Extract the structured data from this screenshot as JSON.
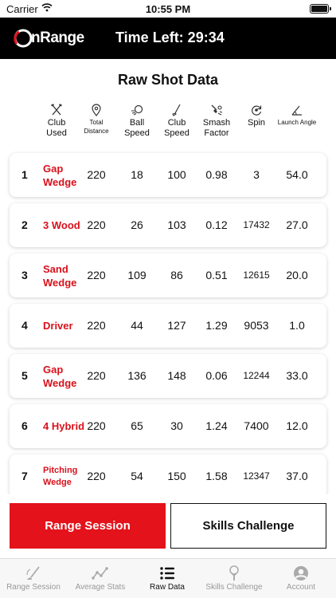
{
  "status_bar": {
    "carrier": "Carrier",
    "time": "10:55 PM"
  },
  "header": {
    "logo_text": "nRange",
    "time_left": "Time Left: 29:34"
  },
  "title": "Raw Shot Data",
  "columns": [
    {
      "label": "Club Used",
      "icon": "crossed-clubs-icon"
    },
    {
      "label": "Total Distance",
      "icon": "location-pin-icon"
    },
    {
      "label": "Ball Speed",
      "icon": "speeding-ball-icon"
    },
    {
      "label": "Club Speed",
      "icon": "golf-club-icon"
    },
    {
      "label": "Smash Factor",
      "icon": "impact-icon"
    },
    {
      "label": "Spin",
      "icon": "spin-icon"
    },
    {
      "label": "Launch Angle",
      "icon": "angle-icon"
    }
  ],
  "shots": [
    {
      "num": "1",
      "club": "Gap Wedge",
      "distance": "220",
      "ball_speed": "18",
      "club_speed": "100",
      "smash": "0.98",
      "spin": "3",
      "launch": "54.0"
    },
    {
      "num": "2",
      "club": "3 Wood",
      "distance": "220",
      "ball_speed": "26",
      "club_speed": "103",
      "smash": "0.12",
      "spin": "17432",
      "launch": "27.0"
    },
    {
      "num": "3",
      "club": "Sand Wedge",
      "distance": "220",
      "ball_speed": "109",
      "club_speed": "86",
      "smash": "0.51",
      "spin": "12615",
      "launch": "20.0"
    },
    {
      "num": "4",
      "club": "Driver",
      "distance": "220",
      "ball_speed": "44",
      "club_speed": "127",
      "smash": "1.29",
      "spin": "9053",
      "launch": "1.0"
    },
    {
      "num": "5",
      "club": "Gap Wedge",
      "distance": "220",
      "ball_speed": "136",
      "club_speed": "148",
      "smash": "0.06",
      "spin": "12244",
      "launch": "33.0"
    },
    {
      "num": "6",
      "club": "4 Hybrid",
      "distance": "220",
      "ball_speed": "65",
      "club_speed": "30",
      "smash": "1.24",
      "spin": "7400",
      "launch": "12.0"
    },
    {
      "num": "7",
      "club": "Pitching Wedge",
      "distance": "220",
      "ball_speed": "54",
      "club_speed": "150",
      "smash": "1.58",
      "spin": "12347",
      "launch": "37.0"
    }
  ],
  "buttons": {
    "range_session": "Range Session",
    "skills_challenge": "Skills Challenge"
  },
  "tabs": [
    {
      "label": "Range Session",
      "icon": "golf-club-swing-icon",
      "active": false
    },
    {
      "label": "Average Stats",
      "icon": "line-chart-icon",
      "active": false
    },
    {
      "label": "Raw Data",
      "icon": "list-icon",
      "active": true
    },
    {
      "label": "Skills Challenge",
      "icon": "golf-tee-icon",
      "active": false
    },
    {
      "label": "Account",
      "icon": "account-icon",
      "active": false
    }
  ],
  "colors": {
    "accent": "#e3121b",
    "header_bg": "#000000",
    "club_text": "#d9111b"
  }
}
